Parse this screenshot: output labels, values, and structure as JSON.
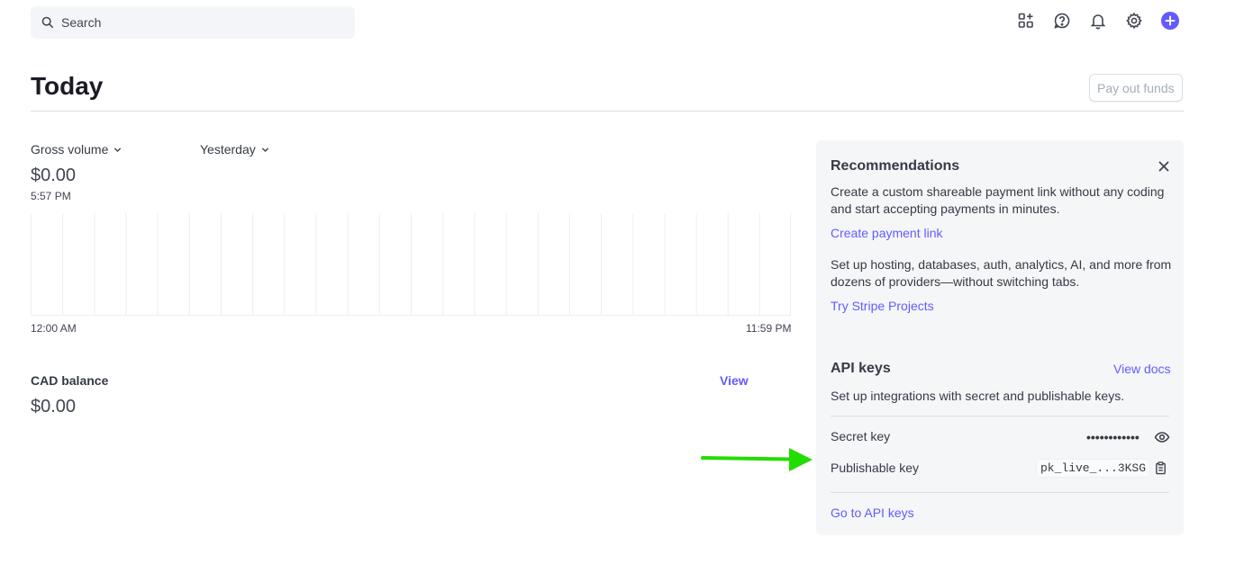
{
  "search": {
    "placeholder": "Search"
  },
  "topbar": {
    "icons": [
      "apps-add-icon",
      "help-icon",
      "bell-icon",
      "gear-icon",
      "plus-icon"
    ],
    "accent": "#635bff"
  },
  "page": {
    "title": "Today",
    "payout_label": "Pay out funds"
  },
  "gross": {
    "metric_label": "Gross volume",
    "compare_label": "Yesterday",
    "value": "$0.00",
    "time": "5:57 PM",
    "x_start": "12:00 AM",
    "x_end": "11:59 PM"
  },
  "balance": {
    "label": "CAD balance",
    "view_label": "View",
    "value": "$0.00"
  },
  "recommendations": {
    "title": "Recommendations",
    "items": [
      {
        "text": "Create a custom shareable payment link without any coding and start accepting payments in minutes.",
        "link": "Create payment link"
      },
      {
        "text": "Set up hosting, databases, auth, analytics, AI, and more from dozens of providers—without switching tabs.",
        "link": "Try Stripe Projects"
      }
    ]
  },
  "api_keys": {
    "title": "API keys",
    "docs_label": "View docs",
    "description": "Set up integrations with secret and publishable keys.",
    "secret_label": "Secret key",
    "secret_value": "••••••••••••",
    "publishable_label": "Publishable key",
    "publishable_value": "pk_live_...3KSG",
    "goto_label": "Go to API keys"
  },
  "annotation": {
    "arrow_color": "#22dd00"
  }
}
